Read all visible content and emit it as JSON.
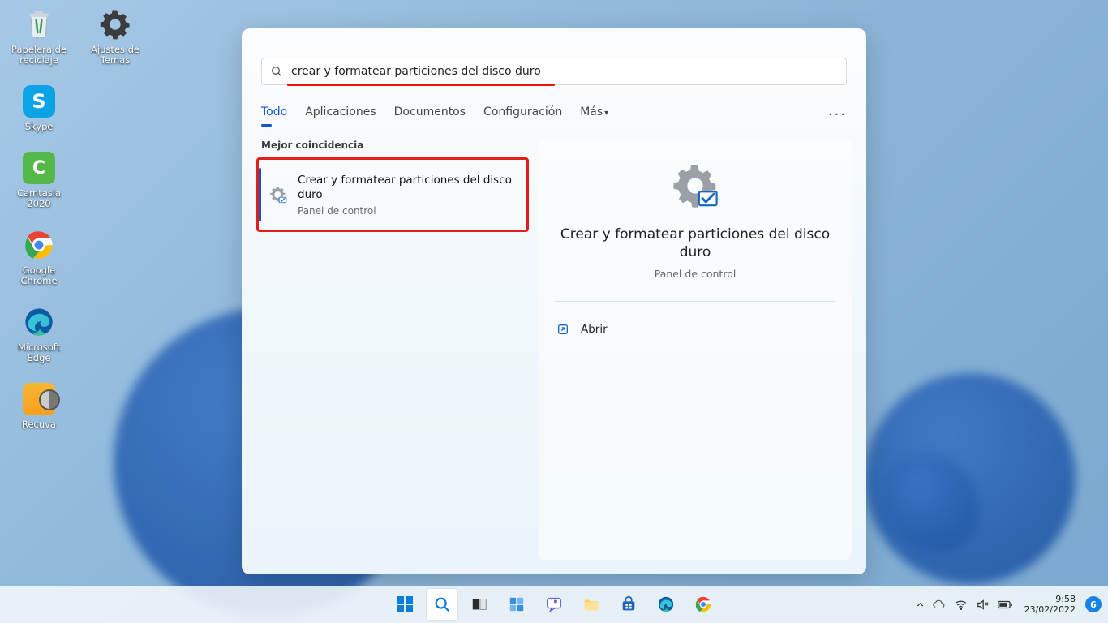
{
  "desktop": {
    "recycle_bin": "Papelera de reciclaje",
    "theme_settings": "Ajustes de Temas",
    "skype": "Skype",
    "camtasia": "Camtasia 2020",
    "chrome": "Google Chrome",
    "edge": "Microsoft Edge",
    "recuva": "Recuva"
  },
  "search": {
    "query": "crear y formatear particiones del disco duro",
    "tabs": {
      "all": "Todo",
      "apps": "Aplicaciones",
      "docs": "Documentos",
      "settings": "Configuración",
      "more": "Más"
    },
    "best_match_label": "Mejor coincidencia",
    "result": {
      "title": "Crear y formatear particiones del disco duro",
      "subtitle": "Panel de control"
    },
    "preview": {
      "title": "Crear y formatear particiones del disco duro",
      "subtitle": "Panel de control"
    },
    "actions": {
      "open": "Abrir"
    }
  },
  "taskbar": {
    "time": "9:58",
    "date": "23/02/2022",
    "notif_count": "6"
  }
}
